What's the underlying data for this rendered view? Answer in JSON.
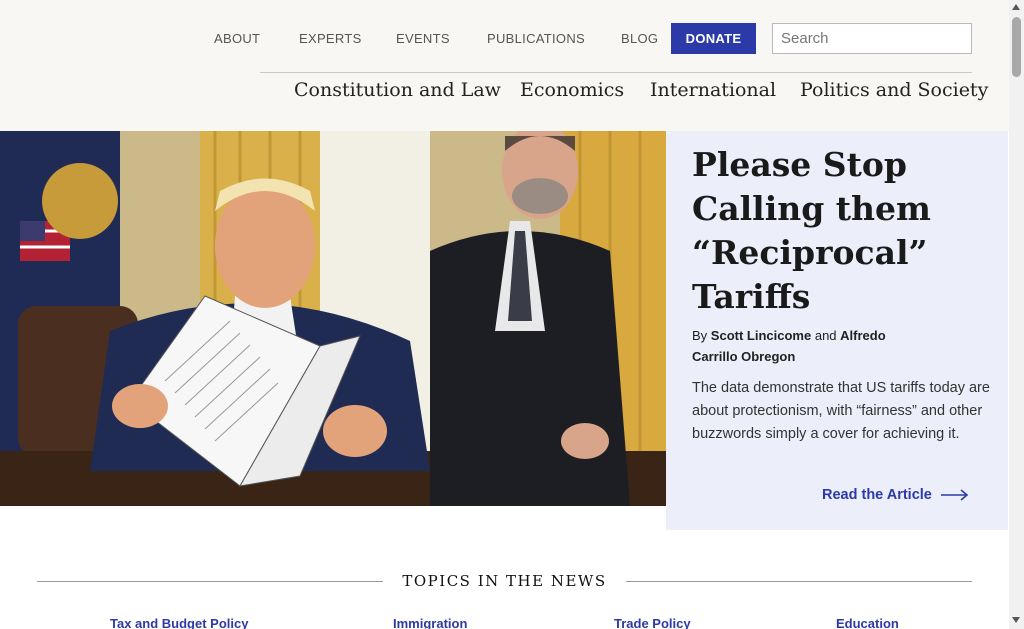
{
  "header": {
    "top_nav": {
      "about": "ABOUT",
      "experts": "EXPERTS",
      "events": "EVENTS",
      "publications": "PUBLICATIONS",
      "blog": "BLOG"
    },
    "donate_label": "DONATE",
    "search_placeholder": "Search",
    "categories": {
      "constitution": "Constitution and Law",
      "economics": "Economics",
      "international": "International",
      "politics": "Politics and Society"
    }
  },
  "hero": {
    "title": "Please Stop Calling them “Reciprocal” Tariffs",
    "byline_prefix": "By",
    "author1": "Scott Lincicome",
    "byline_and": "and",
    "author2": "Alfredo Carrillo Obregon",
    "excerpt": "The data demonstrate that US tariffs today are about protectionism, with “fairness” and other buzzwords simply a cover for achieving it.",
    "read_more": "Read the Article",
    "accent_color": "#2b3aa8",
    "panel_color": "#eceef9"
  },
  "topics": {
    "heading": "TOPICS IN THE NEWS",
    "items": [
      "Tax and Budget Policy",
      "Immigration",
      "Trade Policy",
      "Education"
    ]
  }
}
